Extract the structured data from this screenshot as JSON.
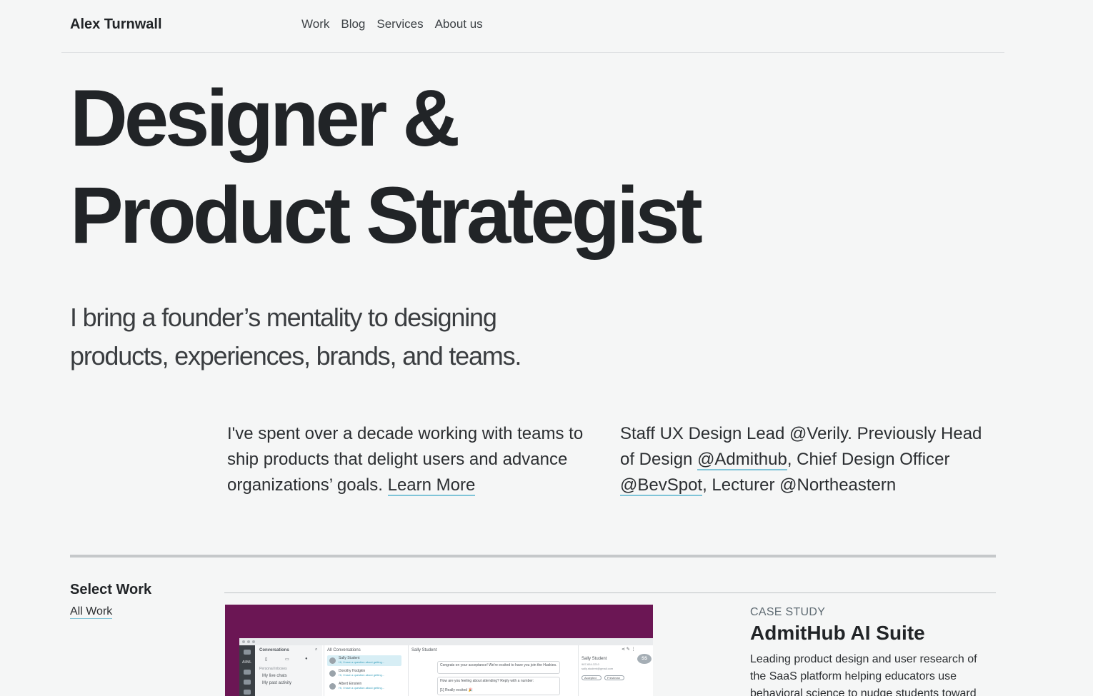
{
  "header": {
    "brand": "Alex Turnwall",
    "nav": [
      "Work",
      "Blog",
      "Services",
      "About us"
    ]
  },
  "hero": {
    "title_line1": "Designer &",
    "title_line2": "Product Strategist",
    "subtitle": "I bring a founder’s mentality to designing products, experiences, brands, and teams."
  },
  "intro": {
    "left_text": "I've spent over a decade working with teams to ship products that delight users and advance organizations’ goals.",
    "left_link": "Learn More",
    "right_prefix": "Staff UX Design Lead @Verily. Previously Head of Design",
    "right_link1": "@Admithub",
    "right_mid": ", Chief Design Officer",
    "right_link2": "@BevSpot",
    "right_suffix": ", Lecturer @Northeastern"
  },
  "select_work": {
    "title": "Select Work",
    "all_link": "All Work"
  },
  "case_study": {
    "kicker": "CASE STUDY",
    "title": "AdmitHub AI Suite",
    "description": "Leading product design and user research of the SaaS platform helping educators use behavioral science to nudge students toward",
    "mock": {
      "conversations": "Conversations",
      "personal_inboxes": "Personal Inboxes",
      "my_live_chats": "My live chats",
      "my_past_activity": "My past activity",
      "all_conversations": "All Conversations",
      "contact1": "Sally Student",
      "contact1_preview": "Hi, I have a question about getting...",
      "contact2": "Dorothy Hodgkin",
      "contact2_preview": "Hi, I have a question about getting...",
      "contact3": "Albert Einstein",
      "contact3_preview": "Hi, I have a question about getting...",
      "thread_name": "Sally Student",
      "msg1": "Congrats on your acceptance! We're excited to have you join the Huskies.",
      "msg2": "How are you feeling about attending? Reply with a number:",
      "msg2b": "[1] Really excited 🎉",
      "profile_name": "Sally Student",
      "profile_phone": "987-654-3210",
      "profile_email": "sally.student@gmail.com",
      "initials": "SS",
      "chip1": "Accepted",
      "chip2": "Freshman",
      "rail_badge": "AI/ML"
    }
  },
  "colors": {
    "background": "#f5f6f6",
    "text": "#212427",
    "link_underline": "#7fc4d8",
    "image_bg": "#6b1654"
  }
}
